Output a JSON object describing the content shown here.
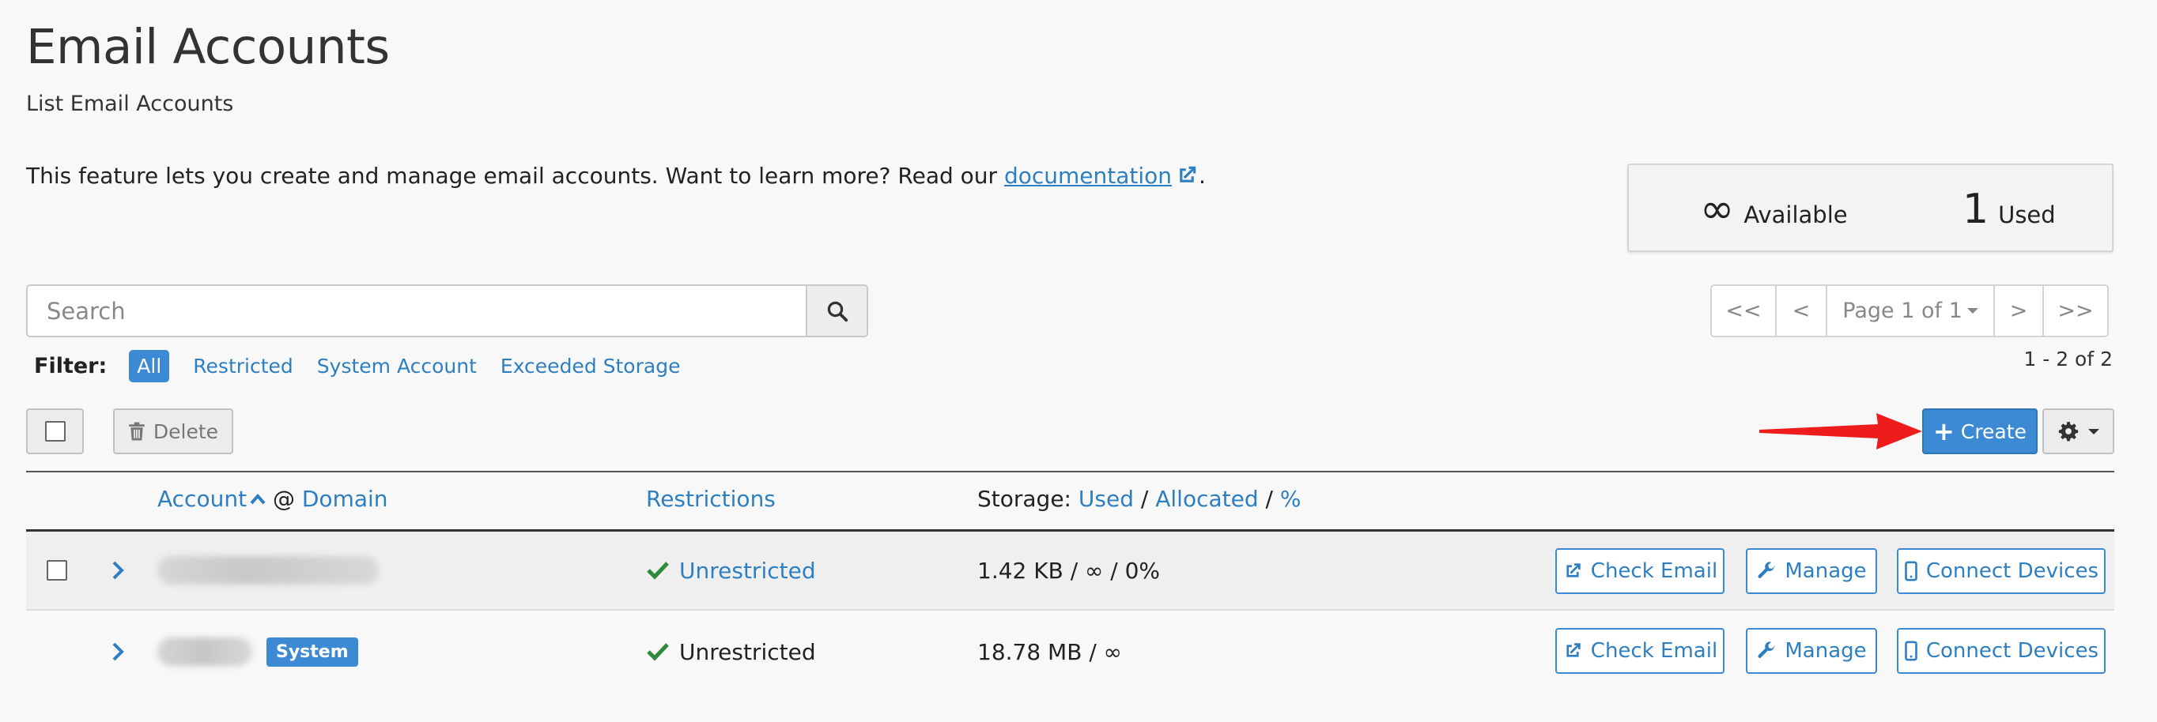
{
  "header": {
    "title": "Email Accounts",
    "subtitle": "List Email Accounts"
  },
  "intro": {
    "text_before": "This feature lets you create and manage email accounts. Want to learn more? Read our ",
    "link_text": "documentation",
    "text_after": "."
  },
  "stats": {
    "available_value": "∞",
    "available_label": "Available",
    "used_value": "1",
    "used_label": "Used"
  },
  "search": {
    "placeholder": "Search"
  },
  "filter": {
    "label": "Filter:",
    "options": [
      "All",
      "Restricted",
      "System Account",
      "Exceeded Storage"
    ],
    "active": "All"
  },
  "pagination": {
    "first": "<<",
    "prev": "<",
    "page_label": "Page 1 of 1",
    "next": ">",
    "last": ">>",
    "range": "1 - 2 of 2"
  },
  "toolbar": {
    "delete_label": "Delete",
    "create_label": "Create"
  },
  "table": {
    "col_account": "Account",
    "col_at": "@",
    "col_domain": "Domain",
    "col_restrictions": "Restrictions",
    "col_storage_prefix": "Storage:",
    "col_used": "Used",
    "col_allocated": "Allocated",
    "col_percent": "%",
    "sep": "/",
    "rows": [
      {
        "restriction": "Unrestricted",
        "storage": "1.42 KB / ∞ / 0%",
        "check_email": "Check Email",
        "manage": "Manage",
        "connect": "Connect Devices"
      },
      {
        "badge": "System",
        "restriction": "Unrestricted",
        "storage": "18.78 MB / ∞",
        "check_email": "Check Email",
        "manage": "Manage",
        "connect": "Connect Devices"
      }
    ]
  },
  "colors": {
    "accent": "#3b8ad3",
    "link": "#2e7fc1",
    "success": "#2f8a3d",
    "arrow": "#ee1c1c"
  }
}
